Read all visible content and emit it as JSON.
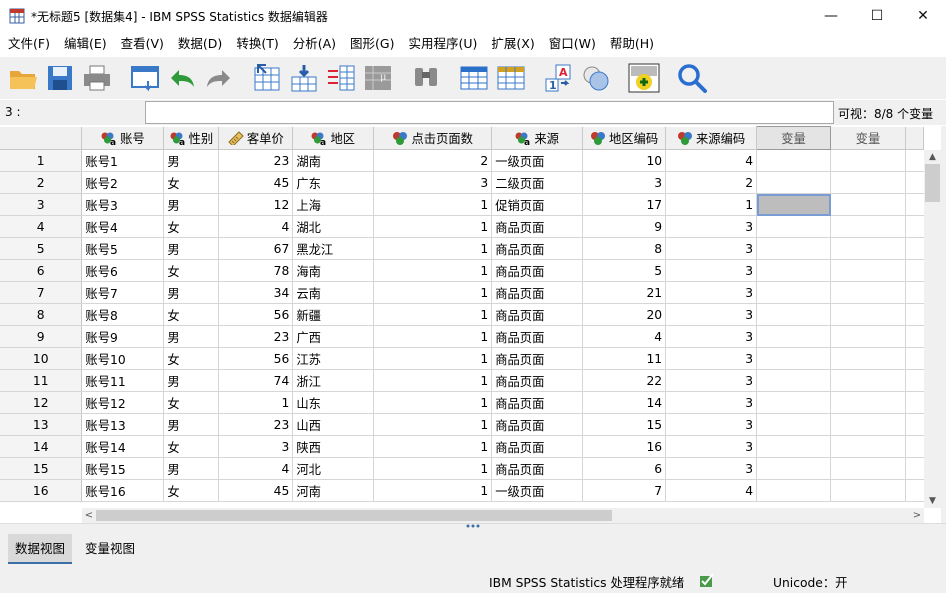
{
  "window": {
    "title": "*无标题5 [数据集4] - IBM SPSS Statistics 数据编辑器",
    "minimize": "—",
    "maximize": "☐",
    "close": "✕"
  },
  "menu": [
    "文件(F)",
    "编辑(E)",
    "查看(V)",
    "数据(D)",
    "转换(T)",
    "分析(A)",
    "图形(G)",
    "实用程序(U)",
    "扩展(X)",
    "窗口(W)",
    "帮助(H)"
  ],
  "toolbar": [
    {
      "name": "open-icon",
      "color": "#e8a53a"
    },
    {
      "name": "save-icon",
      "color": "#3a78c8"
    },
    {
      "name": "print-icon",
      "color": "#777777"
    },
    {
      "name": "recall-dialog-icon",
      "color": "#3a78c8"
    },
    {
      "name": "undo-icon",
      "color": "#2e9a3a"
    },
    {
      "name": "redo-icon",
      "color": "#8a8a8a"
    },
    {
      "name": "goto-case-icon",
      "color": "#3a78c8"
    },
    {
      "name": "goto-variable-icon",
      "color": "#3a78c8"
    },
    {
      "name": "variables-icon",
      "color": "#3a78c8"
    },
    {
      "name": "run-descriptives-icon",
      "color": "#888888"
    },
    {
      "name": "find-icon",
      "color": "#888888"
    },
    {
      "name": "insert-cases-icon",
      "color": "#3a78c8"
    },
    {
      "name": "insert-variable-icon",
      "color": "#d4a020"
    },
    {
      "name": "split-file-icon",
      "color": "#3a78c8"
    },
    {
      "name": "weight-cases-icon",
      "color": "#3a78c8"
    },
    {
      "name": "value-labels-icon",
      "color": "#2e9a3a"
    },
    {
      "name": "search-icon",
      "color": "#2a6fd0"
    }
  ],
  "cellbar": {
    "ref": "3 :",
    "value": "",
    "visible": "可视：8/8 个变量"
  },
  "columns": [
    {
      "label": "账号",
      "icon": "nominal-string-icon",
      "align": "str"
    },
    {
      "label": "性别",
      "icon": "nominal-string-icon",
      "align": "str"
    },
    {
      "label": "客单价",
      "icon": "scale-icon",
      "align": "num"
    },
    {
      "label": "地区",
      "icon": "nominal-string-icon",
      "align": "str"
    },
    {
      "label": "点击页面数",
      "icon": "nominal-icon",
      "align": "num"
    },
    {
      "label": "来源",
      "icon": "nominal-string-icon",
      "align": "str"
    },
    {
      "label": "地区编码",
      "icon": "nominal-icon",
      "align": "num"
    },
    {
      "label": "来源编码",
      "icon": "nominal-icon",
      "align": "num"
    }
  ],
  "empty_columns": [
    "变量",
    "变量"
  ],
  "rows": [
    [
      "1",
      "账号1",
      "男",
      "23",
      "湖南",
      "2",
      "一级页面",
      "10",
      "4"
    ],
    [
      "2",
      "账号2",
      "女",
      "45",
      "广东",
      "3",
      "二级页面",
      "3",
      "2"
    ],
    [
      "3",
      "账号3",
      "男",
      "12",
      "上海",
      "1",
      "促销页面",
      "17",
      "1"
    ],
    [
      "4",
      "账号4",
      "女",
      "4",
      "湖北",
      "1",
      "商品页面",
      "9",
      "3"
    ],
    [
      "5",
      "账号5",
      "男",
      "67",
      "黑龙江",
      "1",
      "商品页面",
      "8",
      "3"
    ],
    [
      "6",
      "账号6",
      "女",
      "78",
      "海南",
      "1",
      "商品页面",
      "5",
      "3"
    ],
    [
      "7",
      "账号7",
      "男",
      "34",
      "云南",
      "1",
      "商品页面",
      "21",
      "3"
    ],
    [
      "8",
      "账号8",
      "女",
      "56",
      "新疆",
      "1",
      "商品页面",
      "20",
      "3"
    ],
    [
      "9",
      "账号9",
      "男",
      "23",
      "广西",
      "1",
      "商品页面",
      "4",
      "3"
    ],
    [
      "10",
      "账号10",
      "女",
      "56",
      "江苏",
      "1",
      "商品页面",
      "11",
      "3"
    ],
    [
      "11",
      "账号11",
      "男",
      "74",
      "浙江",
      "1",
      "商品页面",
      "22",
      "3"
    ],
    [
      "12",
      "账号12",
      "女",
      "1",
      "山东",
      "1",
      "商品页面",
      "14",
      "3"
    ],
    [
      "13",
      "账号13",
      "男",
      "23",
      "山西",
      "1",
      "商品页面",
      "15",
      "3"
    ],
    [
      "14",
      "账号14",
      "女",
      "3",
      "陕西",
      "1",
      "商品页面",
      "16",
      "3"
    ],
    [
      "15",
      "账号15",
      "男",
      "4",
      "河北",
      "1",
      "商品页面",
      "6",
      "3"
    ],
    [
      "16",
      "账号16",
      "女",
      "45",
      "河南",
      "1",
      "一级页面",
      "7",
      "4"
    ]
  ],
  "selected_row": "3",
  "tabs": {
    "data_view": "数据视图",
    "variable_view": "变量视图"
  },
  "status": {
    "processor": "IBM SPSS Statistics 处理程序就绪",
    "unicode": "Unicode：开"
  }
}
